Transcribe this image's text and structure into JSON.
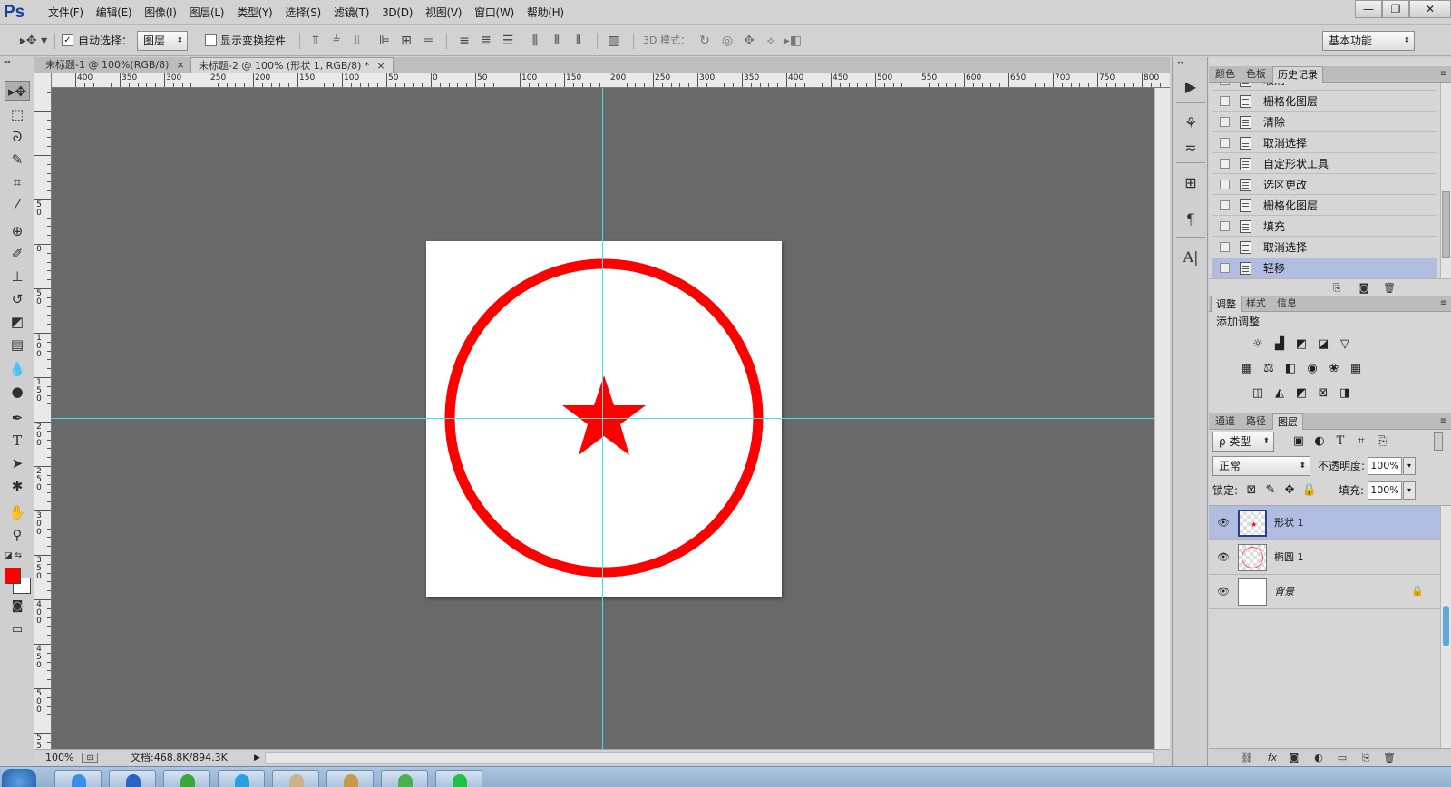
{
  "app": {
    "logo": "Ps"
  },
  "menu": [
    "文件(F)",
    "编辑(E)",
    "图像(I)",
    "图层(L)",
    "类型(Y)",
    "选择(S)",
    "滤镜(T)",
    "3D(D)",
    "视图(V)",
    "窗口(W)",
    "帮助(H)"
  ],
  "window_controls": {
    "minimize": "—",
    "restore": "❐",
    "close": "✕"
  },
  "options": {
    "auto_select_label": "自动选择：",
    "auto_select_checked": true,
    "auto_select_value": "图层",
    "show_transform_label": "显示变换控件",
    "show_transform_checked": false,
    "mode_3d_label": "3D 模式：",
    "workspace": "基本功能"
  },
  "tabs": [
    {
      "label": "未标题-1 @ 100%(RGB/8)",
      "close": "×"
    },
    {
      "label": "未标题-2 @ 100% (形状 1, RGB/8) *",
      "close": "×"
    }
  ],
  "rulers": {
    "h_labels": [
      "400",
      "350",
      "300",
      "250",
      "200",
      "150",
      "100",
      "50",
      "0",
      "50",
      "100",
      "150",
      "200",
      "250",
      "300",
      "350",
      "400",
      "450",
      "500",
      "550",
      "600",
      "650",
      "700",
      "750",
      "800"
    ],
    "v_labels": [
      "50",
      "0",
      "50",
      "100",
      "150",
      "200",
      "250",
      "300",
      "350",
      "400",
      "450",
      "500",
      "550",
      "600"
    ]
  },
  "canvas": {
    "shape_color": "#ff0000",
    "guide_color": "#3fe6e6",
    "background": "#696969"
  },
  "status": {
    "zoom": "100%",
    "doc_info": "文档:468.8K/894.3K"
  },
  "history_panel": {
    "tabs": [
      "颜色",
      "色板",
      "历史记录"
    ],
    "active_tab": 2,
    "items": [
      {
        "label": "取消"
      },
      {
        "label": "栅格化图层"
      },
      {
        "label": "清除"
      },
      {
        "label": "取消选择"
      },
      {
        "label": "自定形状工具"
      },
      {
        "label": "选区更改"
      },
      {
        "label": "栅格化图层"
      },
      {
        "label": "填充"
      },
      {
        "label": "取消选择"
      },
      {
        "label": "轻移"
      }
    ],
    "selected_index": 9
  },
  "adjustments_panel": {
    "tabs": [
      "调整",
      "样式",
      "信息"
    ],
    "title": "添加调整"
  },
  "layers_panel": {
    "tabs": [
      "通道",
      "路径",
      "图层"
    ],
    "filter_label": "ρ 类型",
    "blend_mode": "正常",
    "opacity_label": "不透明度:",
    "opacity_value": "100%",
    "lock_label": "锁定:",
    "fill_label": "填充:",
    "fill_value": "100%",
    "layers": [
      {
        "name": "形状 1",
        "visible": true,
        "selected": true
      },
      {
        "name": "椭圆 1",
        "visible": true,
        "selected": false
      },
      {
        "name": "背景",
        "visible": true,
        "selected": false,
        "locked": true
      }
    ],
    "footer_icons": [
      "link-icon",
      "fx-icon",
      "mask-icon",
      "adjustment-icon",
      "folder-icon",
      "new-layer-icon",
      "trash-icon"
    ]
  },
  "colors": {
    "foreground": "#ff0000",
    "background": "#ffffff",
    "selection": "#b1bde0"
  }
}
